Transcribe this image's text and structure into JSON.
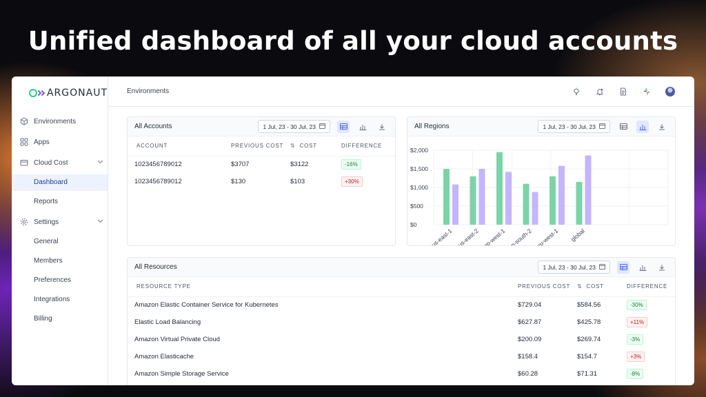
{
  "headline": "Unified dashboard of all your cloud accounts",
  "brand": {
    "name": "ARGONAUT"
  },
  "sidebar": {
    "items": [
      {
        "label": "Environments",
        "icon": "cube-icon"
      },
      {
        "label": "Apps",
        "icon": "grid-icon"
      },
      {
        "label": "Cloud Cost",
        "icon": "wallet-icon",
        "expanded": true,
        "children": [
          {
            "label": "Dashboard",
            "active": true
          },
          {
            "label": "Reports"
          }
        ]
      },
      {
        "label": "Settings",
        "icon": "gear-icon",
        "expanded": true,
        "children": [
          {
            "label": "General"
          },
          {
            "label": "Members"
          },
          {
            "label": "Preferences"
          },
          {
            "label": "Integrations"
          },
          {
            "label": "Billing"
          }
        ]
      }
    ]
  },
  "topbar": {
    "title": "Environments",
    "icons": [
      "lightbulb-icon",
      "bell-icon",
      "document-icon",
      "slack-icon",
      "user-avatar"
    ]
  },
  "accounts": {
    "title": "All Accounts",
    "date_range": "1 Jul, 23 - 30 Jul, 23",
    "columns": [
      "ACCOUNT",
      "PREVIOUS COST",
      "COST",
      "DIFFERENCE"
    ],
    "rows": [
      {
        "account": "1023456789012",
        "previous_cost": "$3707",
        "cost": "$3122",
        "difference": "-16%",
        "trend": "down"
      },
      {
        "account": "1023456789012",
        "previous_cost": "$130",
        "cost": "$103",
        "difference": "+30%",
        "trend": "up"
      }
    ]
  },
  "regions": {
    "title": "All Regions",
    "date_range": "1 Jul, 23 - 30 Jul, 23"
  },
  "chart_data": {
    "type": "bar",
    "categories": [
      "us-east-1",
      "us-east-2",
      "ap-west-1",
      "ap-south-2",
      "eu-west-1",
      "global"
    ],
    "series": [
      {
        "values": [
          1500,
          1300,
          1950,
          1100,
          1300,
          1150
        ],
        "color": "#7dd3a8"
      },
      {
        "values": [
          1080,
          1500,
          1420,
          880,
          1580,
          1860
        ],
        "color": "#c4b5fd"
      }
    ],
    "y_ticks": [
      "$2,000",
      "$1,500",
      "$1,000",
      "$500",
      "$0"
    ],
    "ylim": [
      0,
      2000
    ],
    "grid": true
  },
  "resources": {
    "title": "All Resources",
    "date_range": "1 Jul, 23 - 30 Jul, 23",
    "columns": [
      "RESOURCE TYPE",
      "PREVIOUS COST",
      "COST",
      "DIFFERENCE"
    ],
    "rows": [
      {
        "type": "Amazon Elastic Container Service for Kubernetes",
        "previous_cost": "$729.04",
        "cost": "$584.56",
        "difference": "-30%",
        "trend": "down"
      },
      {
        "type": "Elastic Load Balancing",
        "previous_cost": "$627.87",
        "cost": "$425.78",
        "difference": "+11%",
        "trend": "up"
      },
      {
        "type": "Amazon Virtual Private Cloud",
        "previous_cost": "$200.09",
        "cost": "$269.74",
        "difference": "-3%",
        "trend": "down"
      },
      {
        "type": "Amazon Elasticache",
        "previous_cost": "$158.4",
        "cost": "$154.7",
        "difference": "+3%",
        "trend": "up"
      },
      {
        "type": "Amazon Simple Storage Service",
        "previous_cost": "$60.28",
        "cost": "$71.31",
        "difference": "-8%",
        "trend": "down"
      }
    ]
  }
}
